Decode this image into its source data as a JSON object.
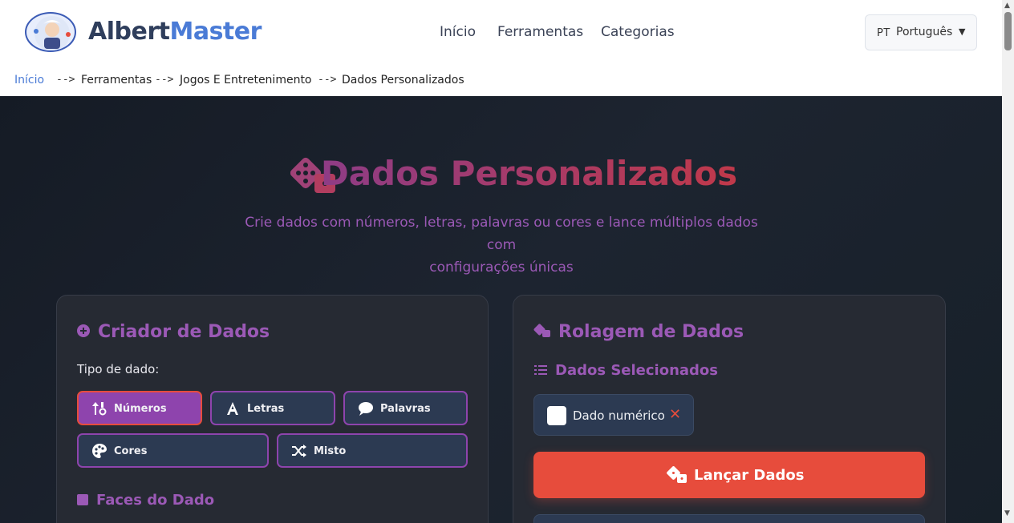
{
  "header": {
    "brand_part1": "Albert",
    "brand_part2": "Master",
    "nav": [
      "Início",
      "Ferramentas",
      "Categorias"
    ],
    "language": {
      "code": "PT",
      "name": "Português"
    }
  },
  "breadcrumb": {
    "items": [
      "Início",
      "Ferramentas",
      "Jogos E Entretenimento",
      "Dados Personalizados"
    ],
    "separator": "-->"
  },
  "hero": {
    "title": "Dados Personalizados",
    "subtitle_line1": "Crie dados com números, letras, palavras ou cores e lance múltiplos dados com",
    "subtitle_line2": "configurações únicas",
    "icon": "dice-icon"
  },
  "creator": {
    "title": "Criador de Dados",
    "type_label": "Tipo de dado:",
    "types": [
      "Números",
      "Letras",
      "Palavras",
      "Cores",
      "Misto"
    ],
    "active_type": "Números",
    "faces_title": "Faces do Dado"
  },
  "roller": {
    "title": "Rolagem de Dados",
    "selected_title": "Dados Selecionados",
    "selected_items": [
      "Dado numérico"
    ],
    "roll_button": "Lançar Dados"
  },
  "colors": {
    "accent_purple": "#9b59b6",
    "accent_red": "#e74c3c",
    "brand_blue": "#4a7bd6"
  }
}
